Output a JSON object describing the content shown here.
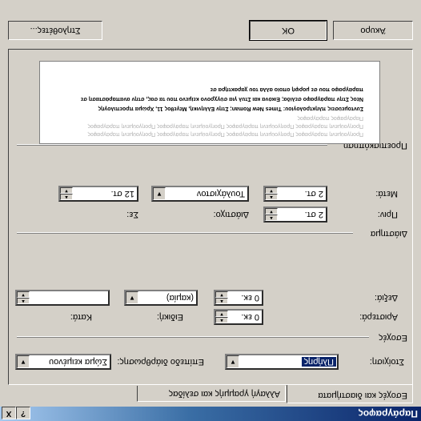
{
  "window": {
    "title": "Παράγραφος",
    "help_label": "?",
    "close_label": "X"
  },
  "tabs": [
    {
      "label": "Εσοχές και διαστήματα"
    },
    {
      "label": "Αλλαγή γραμμής και σελίδας"
    }
  ],
  "general": {
    "alignment_label": "Στοίχιση:",
    "alignment_value": "Πλήρης",
    "outline_label": "Επίπεδο διάρθρωσης:",
    "outline_value": "Σώμα κειμένου"
  },
  "indentation": {
    "group_label": "Εσοχές",
    "left_label": "Αριστερά:",
    "left_value": "0 εκ.",
    "right_label": "Δεξιά:",
    "right_value": "0 εκ.",
    "special_label": "Ειδική:",
    "special_value": "(καμία)",
    "by_label": "Κατά:",
    "by_value": ""
  },
  "spacing": {
    "group_label": "Διάστημα",
    "before_label": "Πριν:",
    "before_value": "2 στ.",
    "after_label": "Μετά:",
    "after_value": "2 στ.",
    "line_label": "Διάστιχο:",
    "line_value": "Τουλάχιστον",
    "at_label": "Σε:",
    "at_value": "12 στ."
  },
  "preview": {
    "group_label": "Προεπισκόπηση",
    "ghost_text": "Προηγούμενη παράγραφος  Προηγούμενη παράγραφος  Προηγούμενη παράγραφος  Προηγούμενη παράγραφος",
    "sample_lines": [
      "Συντομεύσεις πληκτρολογίου: Times New Roman; Στην Ελληνική, Μέγεθος 11, Χρώμα προεπιλογής",
      "Νέος Στην παράγραφο σελίδα; Εικόνα και Στυλ για σύγχρονο κείμενο που τα σας, στην αναπαράσταση σε",
      "παράγραφο που σε μορφή οποίο αλλά του χαρακτήρα σε"
    ],
    "ghost_after": "Παράγραφος παράγραφος"
  },
  "buttons": {
    "tabs_label": "Στηλοθέτες...",
    "ok_label": "OK",
    "cancel_label": "Άκυρο"
  }
}
